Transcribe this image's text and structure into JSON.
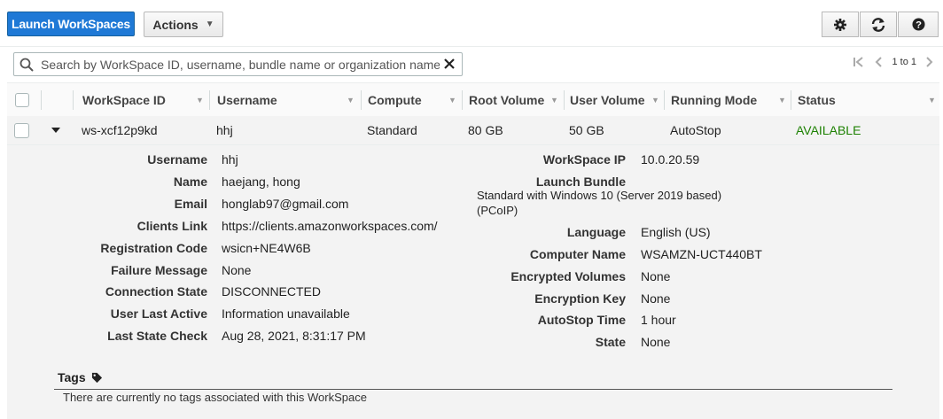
{
  "toolbar": {
    "launch_label": "Launch WorkSpaces",
    "actions_label": "Actions",
    "settings_icon": "gear-icon",
    "refresh_icon": "refresh-icon",
    "help_icon": "help-icon"
  },
  "search": {
    "placeholder": "Search by WorkSpace ID, username, bundle name or organization name",
    "value": ""
  },
  "pager": {
    "count_text": "1 to 1"
  },
  "table": {
    "columns": [
      "WorkSpace ID",
      "Username",
      "Compute",
      "Root Volume",
      "User Volume",
      "Running Mode",
      "Status"
    ],
    "rows": [
      {
        "workspace_id": "ws-xcf12p9kd",
        "username": "hhj",
        "compute": "Standard",
        "root_volume": "80 GB",
        "user_volume": "50 GB",
        "running_mode": "AutoStop",
        "status": "AVAILABLE",
        "status_color": "#1d8102"
      }
    ]
  },
  "detail": {
    "left": [
      {
        "label": "Username",
        "value": "hhj"
      },
      {
        "label": "Name",
        "value": "haejang, hong"
      },
      {
        "label": "Email",
        "value": "honglab97@gmail.com"
      },
      {
        "label": "Clients Link",
        "value": "https://clients.amazonworkspaces.com/"
      },
      {
        "label": "Registration Code",
        "value": "wsicn+NE4W6B"
      },
      {
        "label": "Failure Message",
        "value": "None"
      },
      {
        "label": "Connection State",
        "value": "DISCONNECTED"
      },
      {
        "label": "User Last Active",
        "value": "Information unavailable"
      },
      {
        "label": "Last State Check",
        "value": "Aug 28, 2021, 8:31:17 PM"
      }
    ],
    "workspace_ip": {
      "label": "WorkSpace IP",
      "value": "10.0.20.59"
    },
    "launch_bundle": {
      "label": "Launch Bundle",
      "value_line1": "Standard with Windows 10 (Server 2019 based)",
      "value_line2": "(PCoIP)"
    },
    "right": [
      {
        "label": "Language",
        "value": "English (US)"
      },
      {
        "label": "Computer Name",
        "value": "WSAMZN-UCT440BT"
      },
      {
        "label": "Encrypted Volumes",
        "value": "None"
      },
      {
        "label": "Encryption Key",
        "value": "None"
      },
      {
        "label": "AutoStop Time",
        "value": "1 hour"
      },
      {
        "label": "State",
        "value": "None"
      }
    ],
    "tags": {
      "title": "Tags",
      "empty_text": "There are currently no tags associated with this WorkSpace"
    }
  },
  "colors": {
    "primary": "#1f79d6",
    "available": "#1d8102"
  }
}
